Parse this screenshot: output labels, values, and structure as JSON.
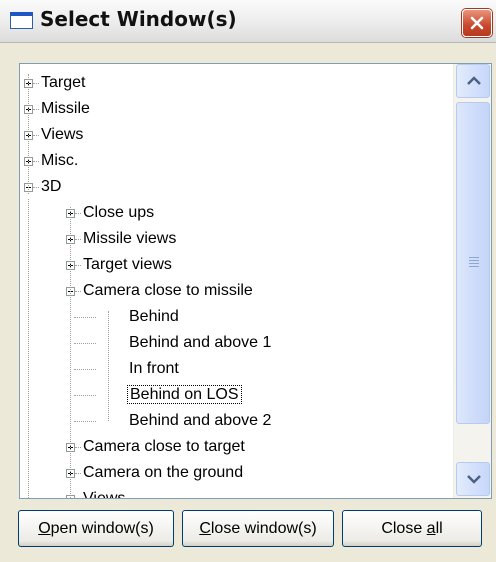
{
  "window": {
    "title": "Select Window(s)"
  },
  "tree": {
    "items": [
      {
        "label": "Target",
        "state": "collapsed",
        "level": 0
      },
      {
        "label": "Missile",
        "state": "collapsed",
        "level": 0
      },
      {
        "label": "Views",
        "state": "collapsed",
        "level": 0
      },
      {
        "label": "Misc.",
        "state": "collapsed",
        "level": 0
      },
      {
        "label": "3D",
        "state": "expanded",
        "level": 0
      },
      {
        "label": "Close ups",
        "state": "collapsed",
        "level": 1
      },
      {
        "label": "Missile views",
        "state": "collapsed",
        "level": 1
      },
      {
        "label": "Target views",
        "state": "collapsed",
        "level": 1
      },
      {
        "label": "Camera close to missile",
        "state": "expanded",
        "level": 1
      },
      {
        "label": "Behind",
        "state": "leaf",
        "level": 2
      },
      {
        "label": "Behind and above 1",
        "state": "leaf",
        "level": 2
      },
      {
        "label": "In front",
        "state": "leaf",
        "level": 2
      },
      {
        "label": "Behind on LOS",
        "state": "leaf",
        "level": 2,
        "selected": true
      },
      {
        "label": "Behind and above 2",
        "state": "leaf",
        "level": 2
      },
      {
        "label": "Camera close to target",
        "state": "collapsed",
        "level": 1
      },
      {
        "label": "Camera on the ground",
        "state": "collapsed",
        "level": 1
      },
      {
        "label": "Views",
        "state": "collapsed",
        "level": 1
      }
    ]
  },
  "buttons": {
    "open": {
      "mnemonic": "O",
      "rest": "pen window(s)"
    },
    "close": {
      "mnemonic": "C",
      "rest": "lose window(s)"
    },
    "close_all": {
      "pre": "Close ",
      "mnemonic": "a",
      "rest": "ll"
    }
  },
  "icons": {
    "close": "close-icon",
    "scroll_up": "scroll-up-arrow-icon",
    "scroll_down": "scroll-down-arrow-icon",
    "window": "window-icon"
  }
}
